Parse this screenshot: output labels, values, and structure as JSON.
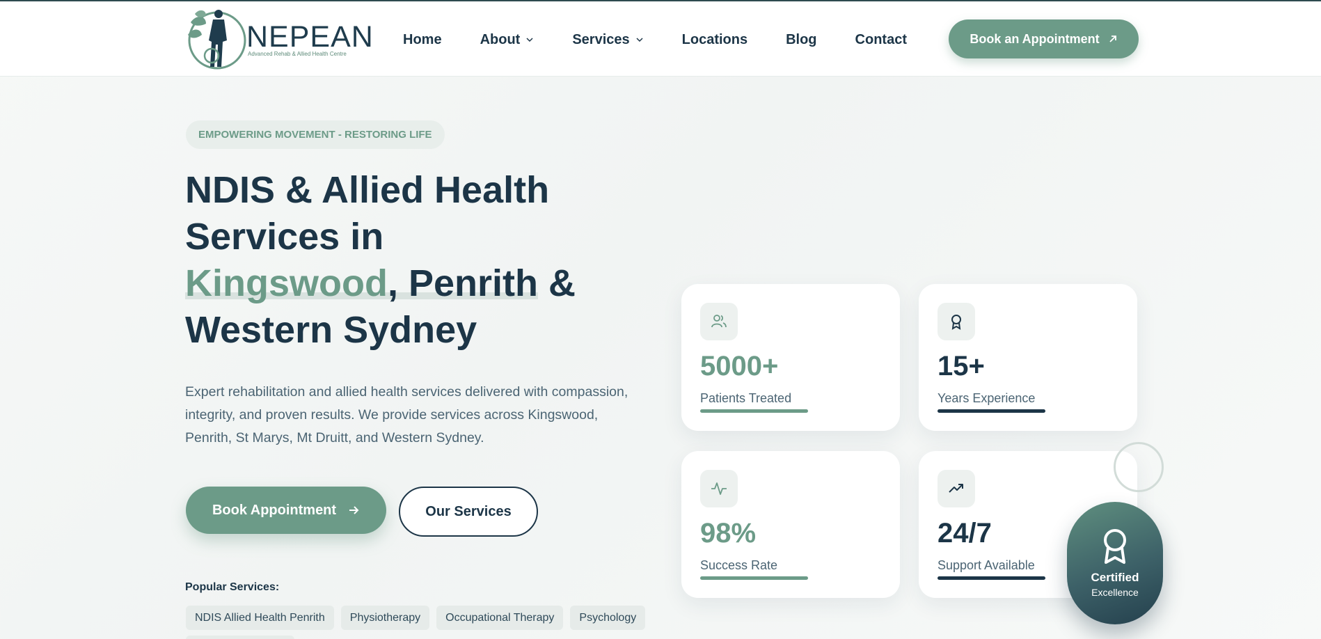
{
  "colors": {
    "primary_green": "#6c9b88",
    "navy": "#1c3547",
    "chip_bg": "#e6ebe9"
  },
  "header": {
    "logo": {
      "name": "NEPEAN",
      "subtitle": "Advanced Rehab & Allied Health Centre"
    },
    "nav": [
      {
        "label": "Home",
        "has_dropdown": false
      },
      {
        "label": "About",
        "has_dropdown": true
      },
      {
        "label": "Services",
        "has_dropdown": true
      },
      {
        "label": "Locations",
        "has_dropdown": false
      },
      {
        "label": "Blog",
        "has_dropdown": false
      },
      {
        "label": "Contact",
        "has_dropdown": false
      }
    ],
    "cta_label": "Book an Appointment",
    "cta_icon": "arrow-up-right-icon"
  },
  "hero": {
    "tagline": "EMPOWERING MOVEMENT - RESTORING LIFE",
    "headline": {
      "line1": "NDIS & Allied Health",
      "line2": "Services in",
      "highlight": "Kingswood",
      "comma_city": ", Penrith",
      "amp": " &",
      "line4": "Western Sydney"
    },
    "description": "Expert rehabilitation and allied health services delivered with compassion, integrity, and proven results. We provide services across Kingswood, Penrith, St Marys, Mt Druitt, and Western Sydney.",
    "primary_button": "Book Appointment",
    "secondary_button": "Our Services",
    "popular_label": "Popular Services:",
    "popular_services": [
      "NDIS Allied Health Penrith",
      "Physiotherapy",
      "Occupational Therapy",
      "Psychology"
    ]
  },
  "stats": [
    {
      "icon": "users-icon",
      "value": "5000+",
      "label": "Patients Treated",
      "accent": "#6c9b88"
    },
    {
      "icon": "award-icon",
      "value": "15+",
      "label": "Years Experience",
      "accent": "#1c3547"
    },
    {
      "icon": "activity-icon",
      "value": "98%",
      "label": "Success Rate",
      "accent": "#6c9b88"
    },
    {
      "icon": "trending-up-icon",
      "value": "24/7",
      "label": "Support Available",
      "accent": "#1c3547"
    }
  ],
  "badge": {
    "icon": "award-icon",
    "title": "Certified",
    "subtitle": "Excellence"
  }
}
